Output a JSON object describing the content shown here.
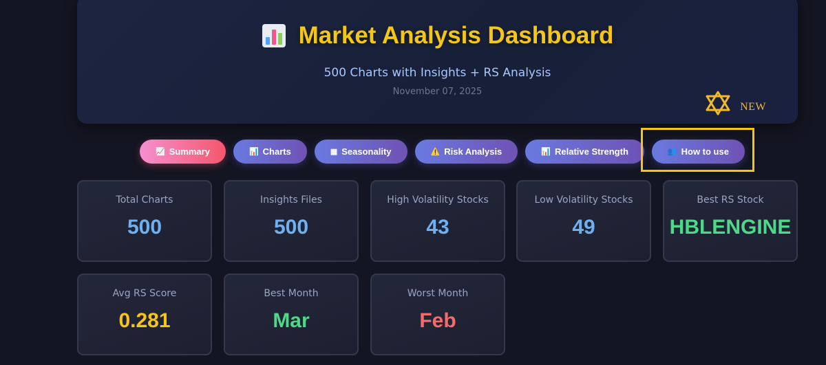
{
  "header": {
    "title": "Market Analysis Dashboard",
    "subtitle": "500 Charts with Insights + RS Analysis",
    "date": "November 07, 2025",
    "new_label": "NEW"
  },
  "tabs": [
    {
      "icon": "📈",
      "label": "Summary",
      "active": true
    },
    {
      "icon": "📊",
      "label": "Charts"
    },
    {
      "icon": "▦",
      "label": "Seasonality"
    },
    {
      "icon": "⚠️",
      "label": "Risk Analysis"
    },
    {
      "icon": "📊",
      "label": "Relative Strength"
    },
    {
      "icon": "👥",
      "label": "How to use"
    }
  ],
  "stats": [
    {
      "label": "Total Charts",
      "value": "500",
      "color": "#6fb0f0"
    },
    {
      "label": "Insights Files",
      "value": "500",
      "color": "#6fb0f0"
    },
    {
      "label": "High Volatility Stocks",
      "value": "43",
      "color": "#6fb0f0"
    },
    {
      "label": "Low Volatility Stocks",
      "value": "49",
      "color": "#6fb0f0"
    },
    {
      "label": "Best RS Stock",
      "value": "HBLENGINE",
      "color": "#4fd88a"
    },
    {
      "label": "Avg RS Score",
      "value": "0.281",
      "color": "#f5c518"
    },
    {
      "label": "Best Month",
      "value": "Mar",
      "color": "#4fd88a"
    },
    {
      "label": "Worst Month",
      "value": "Feb",
      "color": "#f56b6b"
    }
  ],
  "icons": {
    "title": "bar-chart-icon",
    "new": "star-of-david-icon"
  }
}
